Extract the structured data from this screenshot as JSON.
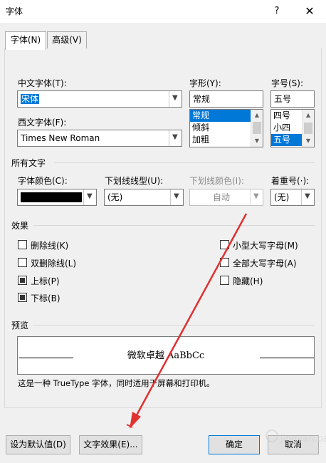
{
  "window": {
    "title": "字体",
    "help": "?",
    "close": "✕"
  },
  "tabs": [
    {
      "label": "字体(N)"
    },
    {
      "label": "高级(V)"
    }
  ],
  "font": {
    "chinese_label": "中文字体(T):",
    "chinese_value": "宋体",
    "western_label": "西文字体(F):",
    "western_value": "Times New Roman",
    "style_label": "字形(Y):",
    "style_value": "常规",
    "style_options": [
      "常规",
      "倾斜",
      "加粗"
    ],
    "size_label": "字号(S):",
    "size_value": "五号",
    "size_options": [
      "四号",
      "小四",
      "五号"
    ]
  },
  "all_text": {
    "section": "所有文字",
    "color_label": "字体颜色(C):",
    "color_value": "#000000",
    "underline_label": "下划线线型(U):",
    "underline_value": "(无)",
    "underline_color_label": "下划线颜色(I):",
    "underline_color_value": "自动",
    "emphasis_label": "着重号(·):",
    "emphasis_value": "(无)"
  },
  "effects": {
    "section": "效果",
    "left": [
      {
        "label": "删除线(K)",
        "checked": false
      },
      {
        "label": "双删除线(L)",
        "checked": false
      },
      {
        "label": "上标(P)",
        "checked": true
      },
      {
        "label": "下标(B)",
        "checked": true
      }
    ],
    "right": [
      {
        "label": "小型大写字母(M)",
        "checked": false
      },
      {
        "label": "全部大写字母(A)",
        "checked": false
      },
      {
        "label": "隐藏(H)",
        "checked": false
      }
    ]
  },
  "preview": {
    "section": "预览",
    "sample": "微软卓越  AaBbCc",
    "note": "这是一种 TrueType 字体，同时适用于屏幕和打印机。"
  },
  "buttons": {
    "set_default": "设为默认值(D)",
    "text_effects": "文字效果(E)...",
    "ok": "确定",
    "cancel": "取消"
  },
  "watermark": {
    "text": "jingyan.baidu.com"
  },
  "colors": {
    "accent": "#0078d7",
    "annotation": "#e03030"
  }
}
